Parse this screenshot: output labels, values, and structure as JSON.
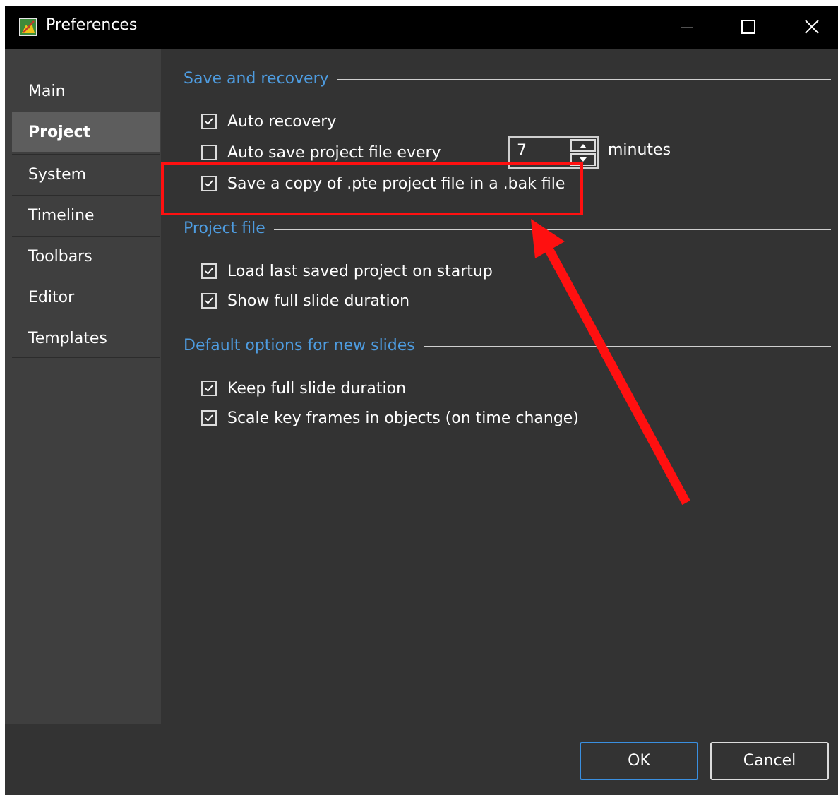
{
  "window": {
    "title": "Preferences"
  },
  "sidebar": {
    "items": [
      {
        "label": "Main",
        "selected": false
      },
      {
        "label": "Project",
        "selected": true
      },
      {
        "label": "System",
        "selected": false
      },
      {
        "label": "Timeline",
        "selected": false
      },
      {
        "label": "Toolbars",
        "selected": false
      },
      {
        "label": "Editor",
        "selected": false
      },
      {
        "label": "Templates",
        "selected": false
      }
    ]
  },
  "sections": {
    "save_recovery": {
      "title": "Save and recovery",
      "auto_recovery": {
        "label": "Auto recovery",
        "checked": true
      },
      "auto_save": {
        "label": "Auto save project file every",
        "checked": false,
        "value": "7",
        "unit": "minutes"
      },
      "bak_copy": {
        "label": "Save a copy of .pte project file in a .bak file",
        "checked": true
      }
    },
    "project_file": {
      "title": "Project file",
      "load_last": {
        "label": "Load last saved project on startup",
        "checked": true
      },
      "show_full": {
        "label": "Show full slide duration",
        "checked": true
      }
    },
    "defaults": {
      "title": "Default options for new slides",
      "keep_full": {
        "label": "Keep full slide duration",
        "checked": true
      },
      "scale_keys": {
        "label": "Scale key frames in objects (on time change)",
        "checked": true
      }
    }
  },
  "footer": {
    "ok_label": "OK",
    "cancel_label": "Cancel"
  },
  "colors": {
    "accent": "#4e9ce0",
    "annotation": "#ff1010"
  },
  "icons": {
    "app": "app-icon",
    "minimize": "minimize-icon",
    "maximize": "maximize-icon",
    "close": "close-icon",
    "check": "check-icon",
    "spin_up": "chevron-up-icon",
    "spin_down": "chevron-down-icon"
  }
}
